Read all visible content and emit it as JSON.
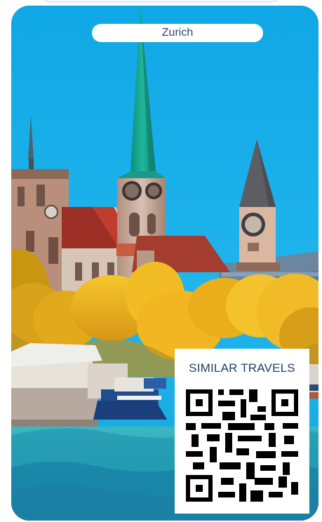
{
  "header": {
    "city": "Zurich"
  },
  "qr_section": {
    "title": "SIMILAR TRAVELS"
  },
  "colors": {
    "sky": "#16a9e3",
    "title": "#1f3f66",
    "pill_text": "#304a66",
    "spire": "#14a98f"
  },
  "icons": {
    "qr": "qr-code-icon"
  }
}
